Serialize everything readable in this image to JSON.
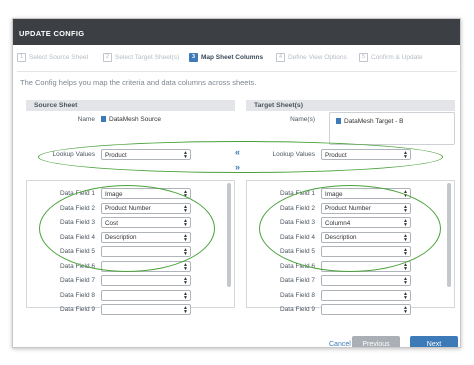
{
  "dialog": {
    "title": "UPDATE CONFIG"
  },
  "steps": [
    {
      "num": "1",
      "label": "Select Source Sheet"
    },
    {
      "num": "2",
      "label": "Select Target Sheet(s)"
    },
    {
      "num": "3",
      "label": "Map Sheet Columns"
    },
    {
      "num": "4",
      "label": "Define View Options"
    },
    {
      "num": "5",
      "label": "Confirm & Update"
    }
  ],
  "description": "The Config helps you map the criteria and data columns across sheets.",
  "source": {
    "header": "Source Sheet",
    "name_label": "Name",
    "name_value": "DataMesh Source"
  },
  "target": {
    "header": "Target Sheet(s)",
    "name_label": "Name(s)",
    "name_value": "DataMesh Target - B"
  },
  "lookup": {
    "label": "Lookup Values",
    "source_value": "Product",
    "target_value": "Product"
  },
  "chevrons": {
    "left": "«",
    "right": "»"
  },
  "source_fields": [
    {
      "label": "Data Field 1",
      "value": "Image"
    },
    {
      "label": "Data Field 2",
      "value": "Product Number"
    },
    {
      "label": "Data Field 3",
      "value": "Cost"
    },
    {
      "label": "Data Field 4",
      "value": "Description"
    },
    {
      "label": "Data Field 5",
      "value": ""
    },
    {
      "label": "Data Field 6",
      "value": ""
    },
    {
      "label": "Data Field 7",
      "value": ""
    },
    {
      "label": "Data Field 8",
      "value": ""
    },
    {
      "label": "Data Field 9",
      "value": ""
    }
  ],
  "target_fields": [
    {
      "label": "Data Field 1",
      "value": "Image"
    },
    {
      "label": "Data Field 2",
      "value": "Product Number"
    },
    {
      "label": "Data Field 3",
      "value": "Column4"
    },
    {
      "label": "Data Field 4",
      "value": "Description"
    },
    {
      "label": "Data Field 5",
      "value": ""
    },
    {
      "label": "Data Field 6",
      "value": ""
    },
    {
      "label": "Data Field 7",
      "value": ""
    },
    {
      "label": "Data Field 8",
      "value": ""
    },
    {
      "label": "Data Field 9",
      "value": ""
    }
  ],
  "buttons": {
    "cancel": "Cancel",
    "previous": "Previous",
    "next": "Next"
  },
  "colors": {
    "accent": "#3d7ab8",
    "header_bg": "#3c3f44",
    "highlight_ring": "#4aa13b",
    "disabled_button": "#a9afb5"
  }
}
